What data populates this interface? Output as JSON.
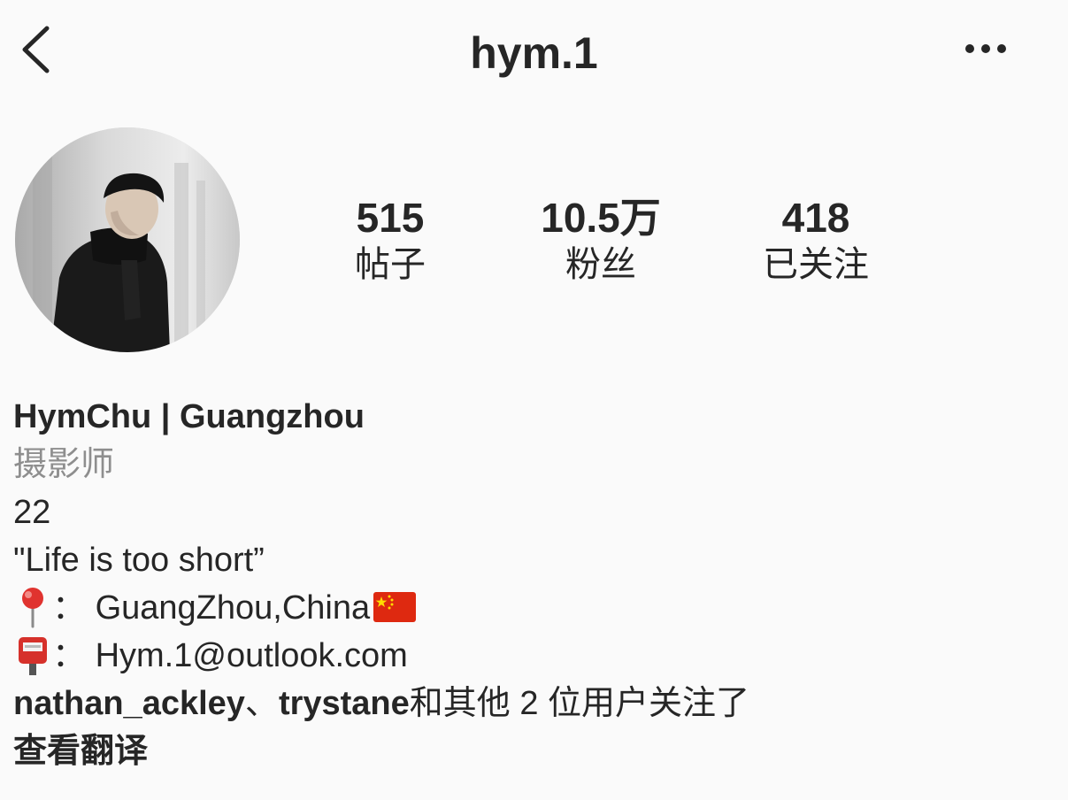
{
  "header": {
    "username": "hym.1",
    "back_icon": "chevron-left-icon",
    "more_icon": "more-horizontal-icon"
  },
  "profile": {
    "avatar_alt": "profile photo",
    "stats": [
      {
        "value": "515",
        "label": "帖子"
      },
      {
        "value": "10.5万",
        "label": "粉丝"
      },
      {
        "value": "418",
        "label": "已关注"
      }
    ]
  },
  "bio": {
    "name": "HymChu | Guangzhou",
    "category": "摄影师",
    "age": "22",
    "quote": "\"Life is too short”",
    "location_sep": "：",
    "location": "GuangZhou,China",
    "email_sep": "：",
    "email": "Hym.1@outlook.com",
    "followed_by": {
      "user1": "nathan_ackley",
      "sep": "、",
      "user2": "trystane",
      "rest": "和其他 2 位用户关注了"
    },
    "translate": "查看翻译"
  },
  "colors": {
    "background": "#fafafa",
    "text": "#262626",
    "secondary": "#8e8e8e"
  }
}
